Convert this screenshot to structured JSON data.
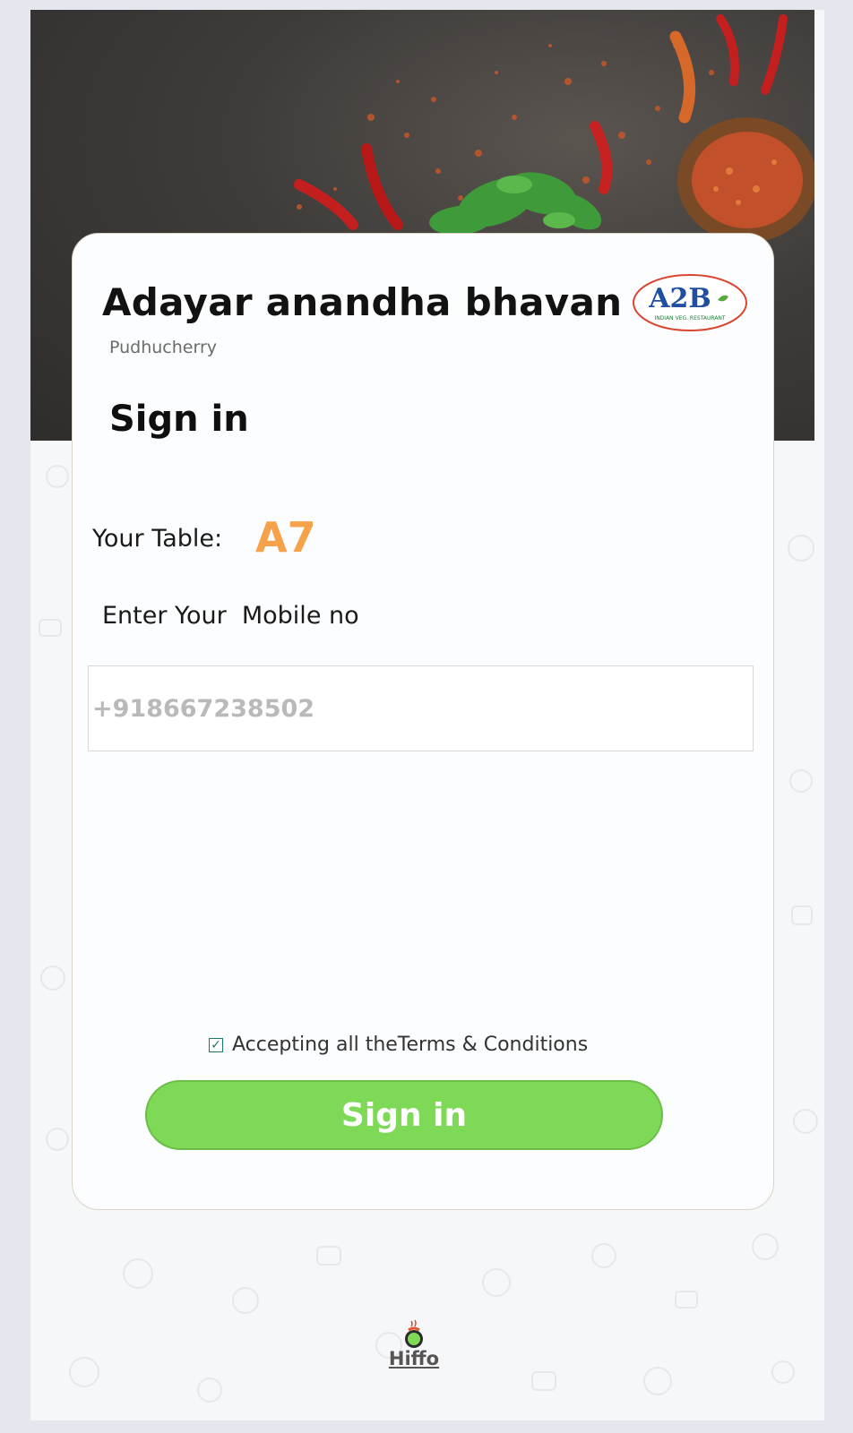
{
  "restaurant": {
    "name": "Adayar anandha bhavan",
    "city": "Pudhucherry",
    "logo_text": "A2B",
    "logo_tagline": "INDIAN VEG. RESTAURANT"
  },
  "signin": {
    "title": "Sign in",
    "table_label": "Your Table:",
    "table_value": "A7",
    "mobile_label": "Enter Your  Mobile no",
    "mobile_placeholder": "+918667238502",
    "terms_text": "Accepting all theTerms & Conditions",
    "terms_checked": true,
    "button_label": "Sign in"
  },
  "footer": {
    "brand_name": "Hiffo"
  },
  "colors": {
    "accent_orange": "#f5a24a",
    "button_green": "#7ed957",
    "checkbox_teal": "#1b7a6c"
  },
  "icons": [
    "check-icon",
    "hiffo-logo-icon",
    "a2b-logo"
  ]
}
